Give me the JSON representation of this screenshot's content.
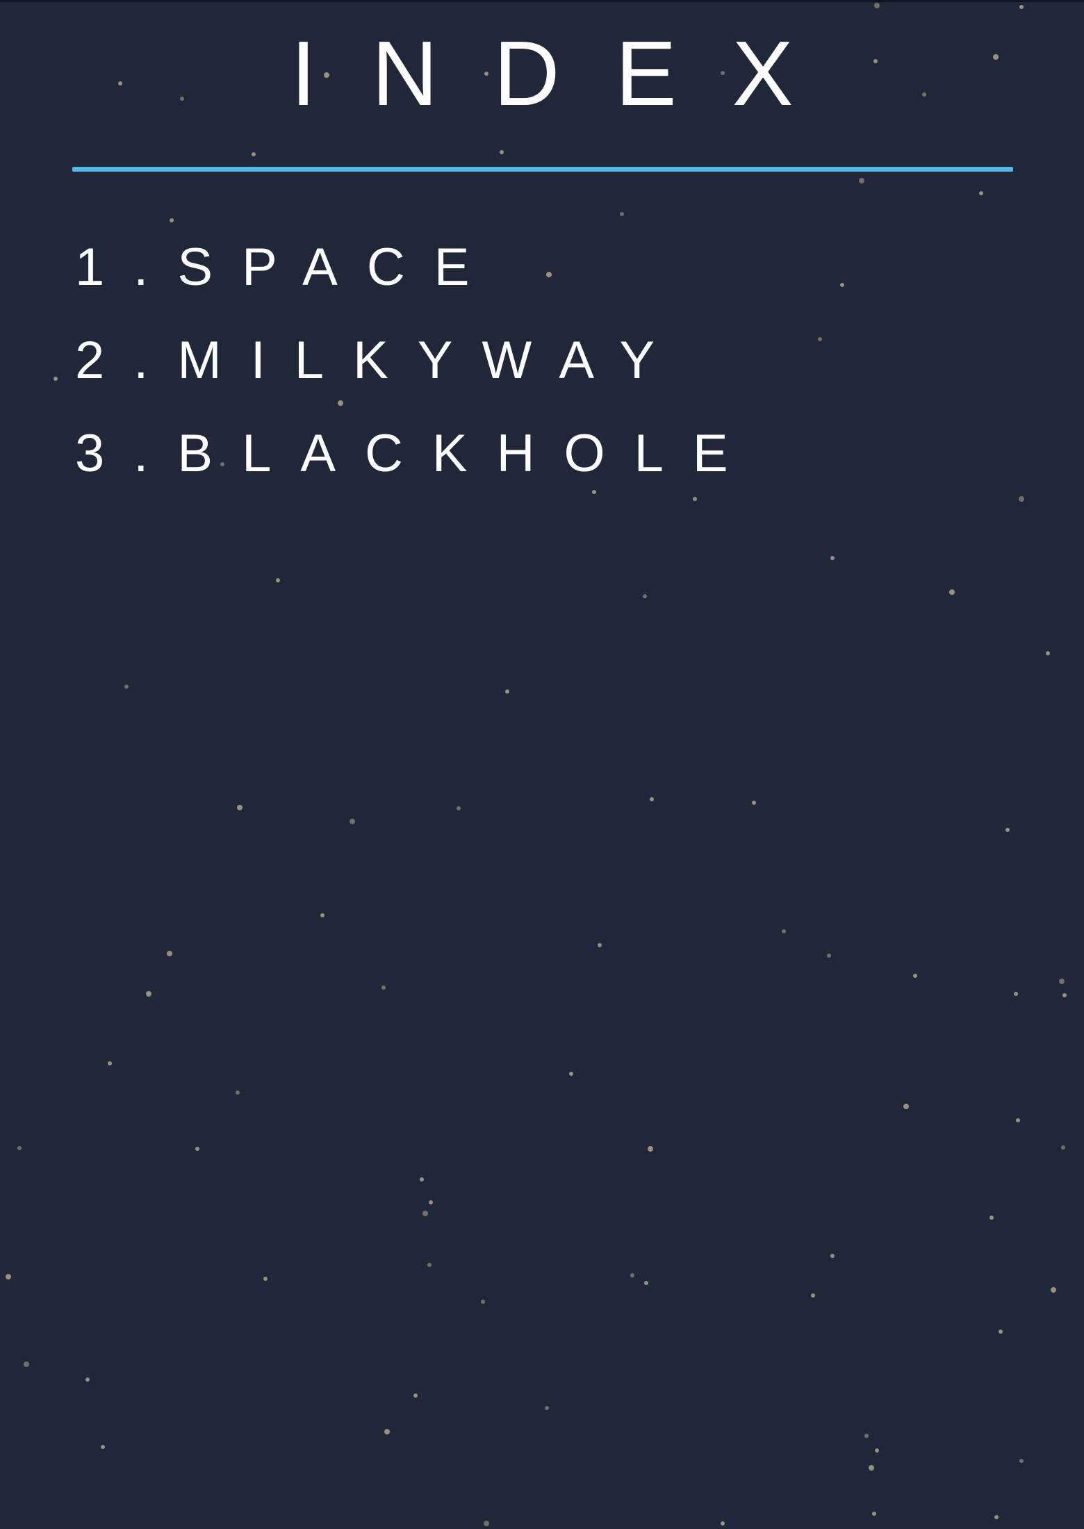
{
  "page": {
    "title": "INDEX",
    "colors": {
      "background": "#1f2738",
      "accent_rule": "#4fb8e6",
      "text": "#ffffff",
      "stars": "#b7ad8c"
    }
  },
  "index": {
    "items": [
      {
        "label": "1.SPACE"
      },
      {
        "label": "2.MILKYWAY"
      },
      {
        "label": "3.BLACKHOLE"
      }
    ]
  }
}
